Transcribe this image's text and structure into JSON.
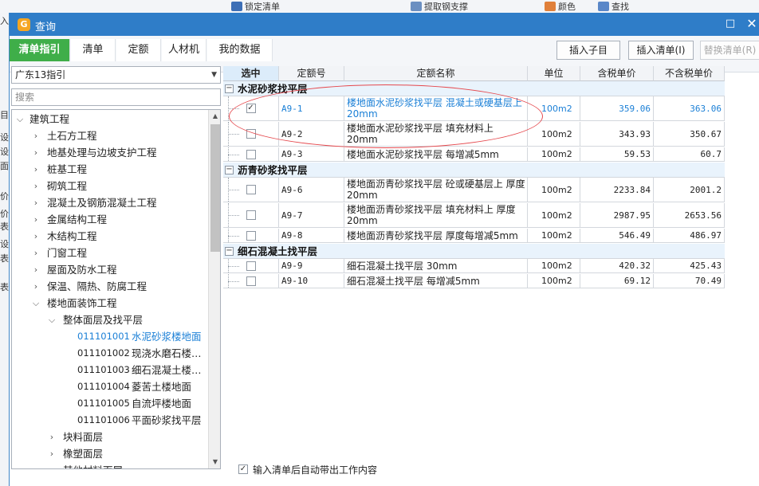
{
  "background_app": {
    "toolbar_items": [
      "锁定清单",
      "提取钢支撑",
      "颜色",
      "查找"
    ],
    "left_strip_chars": [
      "入",
      "目",
      "设",
      "设",
      "面",
      "价",
      "价",
      "表",
      "设",
      "表",
      "表"
    ]
  },
  "dialog": {
    "title": "查询",
    "maximize_glyph": "□",
    "close_glyph": "✕",
    "tabs": [
      {
        "label": "清单指引",
        "active": true
      },
      {
        "label": "清单",
        "active": false
      },
      {
        "label": "定额",
        "active": false
      },
      {
        "label": "人材机",
        "active": false
      },
      {
        "label": "我的数据",
        "active": false
      }
    ],
    "buttons": {
      "insert_child": "插入子目",
      "insert_list": "插入清单(I)",
      "replace_list": "替换清单(R)"
    }
  },
  "left_panel": {
    "guide_select_value": "广东13指引",
    "search_placeholder": "搜索",
    "tree": [
      {
        "level": 0,
        "arrow": "down",
        "label": "建筑工程"
      },
      {
        "level": 1,
        "arrow": "right",
        "label": "土石方工程"
      },
      {
        "level": 1,
        "arrow": "right",
        "label": "地基处理与边坡支护工程"
      },
      {
        "level": 1,
        "arrow": "right",
        "label": "桩基工程"
      },
      {
        "level": 1,
        "arrow": "right",
        "label": "砌筑工程"
      },
      {
        "level": 1,
        "arrow": "right",
        "label": "混凝土及钢筋混凝土工程"
      },
      {
        "level": 1,
        "arrow": "right",
        "label": "金属结构工程"
      },
      {
        "level": 1,
        "arrow": "right",
        "label": "木结构工程"
      },
      {
        "level": 1,
        "arrow": "right",
        "label": "门窗工程"
      },
      {
        "level": 1,
        "arrow": "right",
        "label": "屋面及防水工程"
      },
      {
        "level": 1,
        "arrow": "right",
        "label": "保温、隔热、防腐工程"
      },
      {
        "level": 1,
        "arrow": "down",
        "label": "楼地面装饰工程"
      },
      {
        "level": 2,
        "arrow": "down",
        "label": "整体面层及找平层"
      },
      {
        "level": 3,
        "code": "011101001",
        "label": "水泥砂浆楼地面",
        "selected": true
      },
      {
        "level": 3,
        "code": "011101002",
        "label": "现浇水磨石楼…"
      },
      {
        "level": 3,
        "code": "011101003",
        "label": "细石混凝土楼…"
      },
      {
        "level": 3,
        "code": "011101004",
        "label": "菱苦土楼地面"
      },
      {
        "level": 3,
        "code": "011101005",
        "label": "自流坪楼地面"
      },
      {
        "level": 3,
        "code": "011101006",
        "label": "平面砂浆找平层"
      },
      {
        "level": 2,
        "arrow": "right",
        "label": "块料面层"
      },
      {
        "level": 2,
        "arrow": "right",
        "label": "橡塑面层"
      },
      {
        "level": 2,
        "arrow": "right",
        "label": "其他材料面层"
      }
    ]
  },
  "grid": {
    "headers": [
      "选中",
      "定额号",
      "定额名称",
      "单位",
      "含税单价",
      "不含税单价"
    ],
    "groups": [
      {
        "title": "水泥砂浆找平层",
        "collapse_glyph": "−",
        "rows": [
          {
            "checked": true,
            "code": "A9-1",
            "name": "楼地面水泥砂浆找平层 混凝土或硬基层上 20mm",
            "unit": "100m2",
            "price_tax": "359.06",
            "price_notax": "363.06",
            "highlight": true
          },
          {
            "checked": false,
            "code": "A9-2",
            "name": "楼地面水泥砂浆找平层 填充材料上 20mm",
            "unit": "100m2",
            "price_tax": "343.93",
            "price_notax": "350.67"
          },
          {
            "checked": false,
            "code": "A9-3",
            "name": "楼地面水泥砂浆找平层 每增减5mm",
            "unit": "100m2",
            "price_tax": "59.53",
            "price_notax": "60.7"
          }
        ]
      },
      {
        "title": "沥青砂浆找平层",
        "collapse_glyph": "−",
        "rows": [
          {
            "checked": false,
            "code": "A9-6",
            "name": "楼地面沥青砂浆找平层 砼或硬基层上 厚度20mm",
            "unit": "100m2",
            "price_tax": "2233.84",
            "price_notax": "2001.2"
          },
          {
            "checked": false,
            "code": "A9-7",
            "name": "楼地面沥青砂浆找平层 填充材料上 厚度20mm",
            "unit": "100m2",
            "price_tax": "2987.95",
            "price_notax": "2653.56"
          },
          {
            "checked": false,
            "code": "A9-8",
            "name": "楼地面沥青砂浆找平层 厚度每增减5mm",
            "unit": "100m2",
            "price_tax": "546.49",
            "price_notax": "486.97"
          }
        ]
      },
      {
        "title": "细石混凝土找平层",
        "collapse_glyph": "−",
        "rows": [
          {
            "checked": false,
            "code": "A9-9",
            "name": "细石混凝土找平层 30mm",
            "unit": "100m2",
            "price_tax": "420.32",
            "price_notax": "425.43"
          },
          {
            "checked": false,
            "code": "A9-10",
            "name": "细石混凝土找平层 每增减5mm",
            "unit": "100m2",
            "price_tax": "69.12",
            "price_notax": "70.49"
          }
        ]
      }
    ]
  },
  "footer": {
    "auto_work_content_checked": true,
    "auto_work_content_label": "输入清单后自动带出工作内容"
  },
  "colors": {
    "titlebar": "#2f7dc8",
    "active_tab": "#3fae49",
    "selected_text": "#1a7fd6",
    "annotation_oval": "#e5484d"
  },
  "icons": [
    "app-logo-icon",
    "maximize-icon",
    "close-icon",
    "dropdown-caret-icon",
    "scroll-up-icon",
    "scroll-down-icon",
    "expand-arrow-icon",
    "collapse-arrow-icon",
    "checkbox-icon"
  ]
}
